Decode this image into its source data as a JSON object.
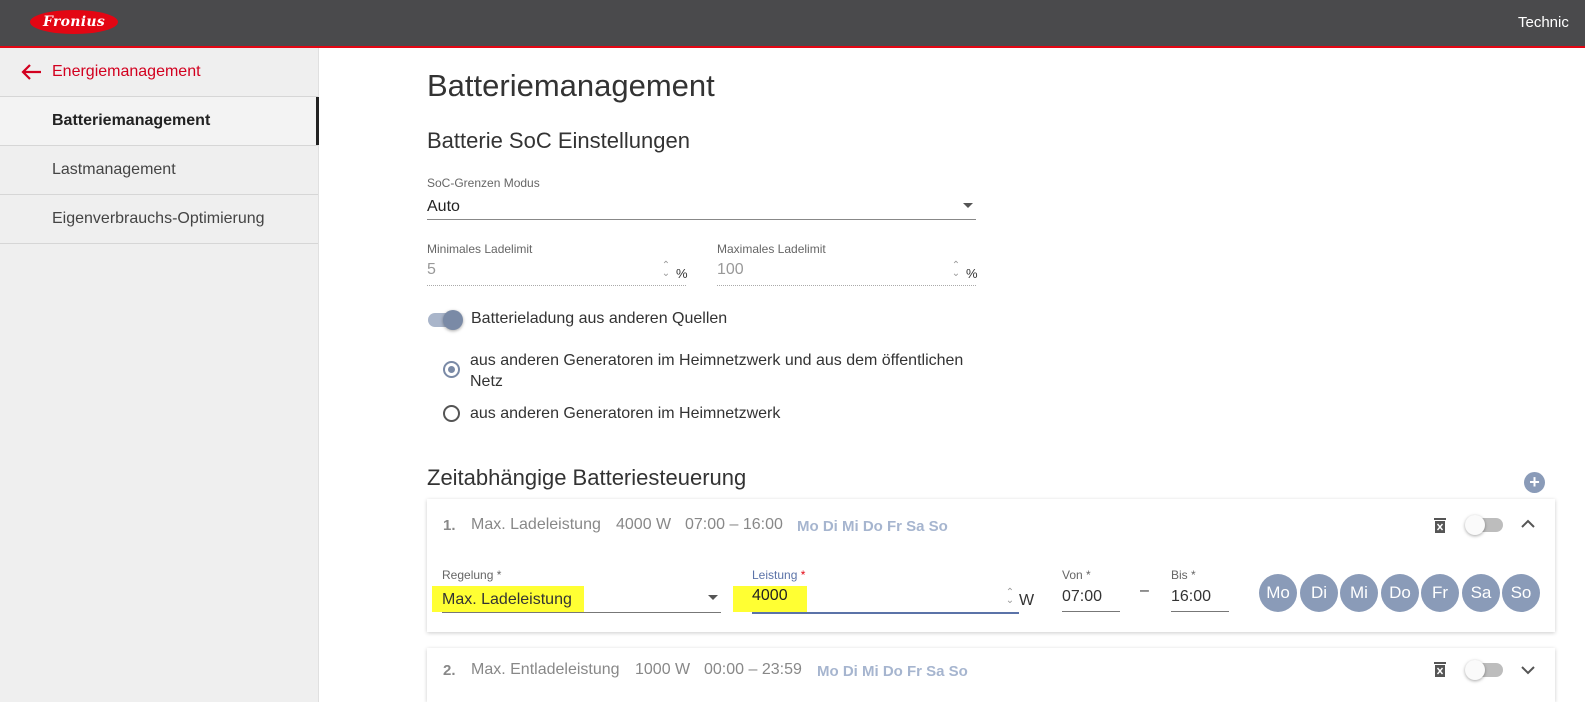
{
  "header": {
    "logo_text": "Fronius",
    "right_text": "Technic"
  },
  "sidebar": {
    "back_label": "Energiemanagement",
    "items": [
      {
        "label": "Batteriemanagement",
        "active": true
      },
      {
        "label": "Lastmanagement",
        "active": false
      },
      {
        "label": "Eigenverbrauchs-Optimierung",
        "active": false
      }
    ]
  },
  "page": {
    "title": "Batteriemanagement",
    "soc_section": {
      "title": "Batterie SoC Einstellungen",
      "mode_label": "SoC-Grenzen Modus",
      "mode_value": "Auto",
      "min_label": "Minimales Ladelimit",
      "min_value": "5",
      "max_label": "Maximales Ladelimit",
      "max_value": "100",
      "unit": "%"
    },
    "charging_toggle_label": "Batterieladung aus anderen Quellen",
    "radio_options": [
      {
        "label_line1": "aus anderen Generatoren im Heimnetzwerk und aus dem öffentlichen",
        "label_line2": "Netz",
        "checked": true
      },
      {
        "label_line1": "aus anderen Generatoren im Heimnetzwerk",
        "checked": false
      }
    ],
    "time_section": {
      "title": "Zeitabhängige Batteriesteuerung",
      "add_label": "+",
      "rules": [
        {
          "num": "1.",
          "type": "Max. Ladeleistung",
          "power": "4000 W",
          "time": "07:00 – 16:00",
          "days": "Mo Di Mi Do Fr Sa So",
          "expanded": true,
          "regelung_label": "Regelung *",
          "regelung_value": "Max. Ladeleistung",
          "leistung_label": "Leistung",
          "leistung_required": "*",
          "leistung_value": "4000",
          "leistung_unit": "W",
          "von_label": "Von *",
          "von_value": "07:00",
          "dash": "–",
          "bis_label": "Bis *",
          "bis_value": "16:00",
          "day_buttons": [
            "Mo",
            "Di",
            "Mi",
            "Do",
            "Fr",
            "Sa",
            "So"
          ]
        },
        {
          "num": "2.",
          "type": "Max. Entladeleistung",
          "power": "1000 W",
          "time": "00:00 – 23:59",
          "days": "Mo Di Mi Do Fr Sa So",
          "expanded": false
        }
      ]
    }
  },
  "colors": {
    "brand_red": "#e30613",
    "accent_blue": "#8a9bb8",
    "highlight": "#ffff33",
    "header_bg": "#4a4a4c"
  },
  "icons": [
    "back-arrow-icon",
    "dropdown-caret-icon",
    "spinner-icon",
    "trash-icon",
    "chevron-up-icon",
    "chevron-down-icon",
    "plus-icon"
  ]
}
